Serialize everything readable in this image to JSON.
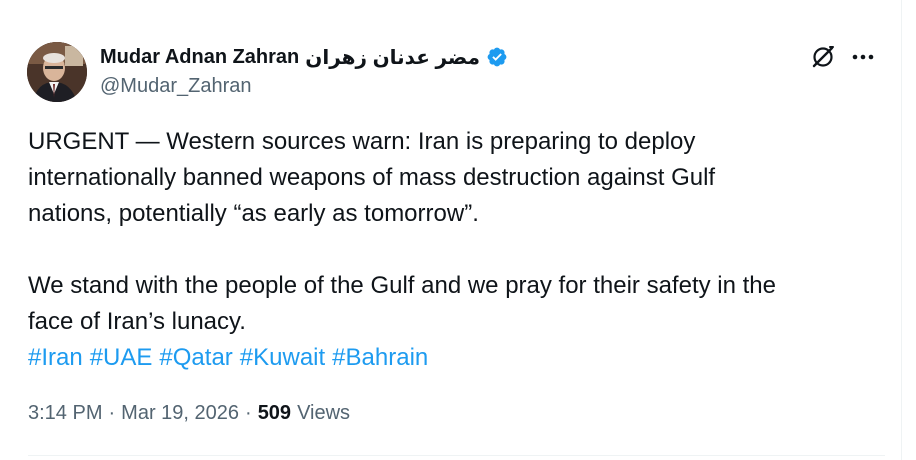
{
  "author": {
    "display_name": "Mudar Adnan Zahran",
    "display_name_arabic": "مضر عدنان زهران",
    "handle": "@Mudar_Zahran",
    "verified": true,
    "verified_icon": "verified-badge-icon"
  },
  "actions": {
    "grok_icon": "grok-slash-icon",
    "more_icon": "more-dots-icon"
  },
  "tweet": {
    "lines_p1": [
      "URGENT — Western sources warn: Iran is preparing to deploy",
      "internationally banned weapons of mass destruction against Gulf",
      "nations, potentially “as early as tomorrow”."
    ],
    "lines_p2": [
      "We stand with the people of the Gulf and we pray for their safety in the",
      "face of Iran’s lunacy."
    ],
    "hashtags": [
      "#Iran",
      "#UAE",
      "#Qatar",
      "#Kuwait",
      "#Bahrain"
    ]
  },
  "meta": {
    "time": "3:14 PM",
    "separator": "·",
    "date": "Mar 19, 2026",
    "views_count": "509",
    "views_label": "Views"
  },
  "colors": {
    "text": "#0f1419",
    "secondary": "#536471",
    "link": "#1d9bf0",
    "verified": "#1d9bf0"
  }
}
